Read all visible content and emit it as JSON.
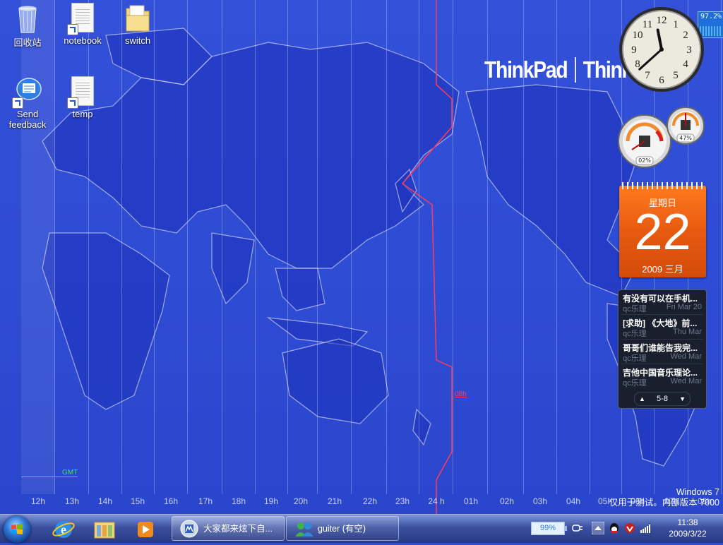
{
  "desktop": {
    "icons": [
      {
        "id": "recycle-bin",
        "label": "回收站"
      },
      {
        "id": "notebook",
        "label": "notebook"
      },
      {
        "id": "switch",
        "label": "switch"
      },
      {
        "id": "send-feedback",
        "label": "Send feedback"
      },
      {
        "id": "temp",
        "label": "temp"
      }
    ],
    "brand": {
      "left": "ThinkPad",
      "right": "ThinkCentre"
    },
    "timezone_hours": [
      "12h",
      "13h",
      "14h",
      "15h",
      "16h",
      "17h",
      "18h",
      "19h",
      "20h",
      "21h",
      "22h",
      "23h",
      "24 h",
      "01h",
      "02h",
      "03h",
      "04h",
      "05h",
      "06h",
      "07h",
      "08h"
    ],
    "dateline_tag": "08h",
    "gmt_tag": "GMT",
    "watermark": {
      "line1": "Windows  7",
      "line2": "仅用于测试。内部版本 7000"
    }
  },
  "gadgets": {
    "cpu_meter_top": "97.2%",
    "clock": {
      "hour": 11,
      "minute": 38
    },
    "meters": {
      "cpu": "02%",
      "memory": "47%"
    },
    "calendar": {
      "weekday": "星期日",
      "day": "22",
      "month": "2009 三月"
    },
    "feed": {
      "items": [
        {
          "title": "有没有可以在手机...",
          "source": "qc乐理",
          "date": "Fri Mar 20"
        },
        {
          "title": "[求助] 《大地》前...",
          "source": "qc乐理",
          "date": "Thu Mar"
        },
        {
          "title": "哥哥们谁能告我完...",
          "source": "qc乐理",
          "date": "Wed Mar"
        },
        {
          "title": "吉他中国音乐理论...",
          "source": "qc乐理",
          "date": "Wed Mar"
        }
      ],
      "page": "5-8"
    }
  },
  "taskbar": {
    "tasks": [
      {
        "id": "ie-window",
        "label": "大家都来炫下自..."
      },
      {
        "id": "messenger",
        "label": "guiter (有空)"
      }
    ],
    "tray": {
      "battery": "99%",
      "time": "11:38",
      "date": "2009/3/22"
    }
  },
  "colors": {
    "desktop_blue": "#2f4fd6",
    "calendar_orange": "#e75a10",
    "dateline_red": "#ff3b5a",
    "gmt_green": "#49e05a"
  }
}
